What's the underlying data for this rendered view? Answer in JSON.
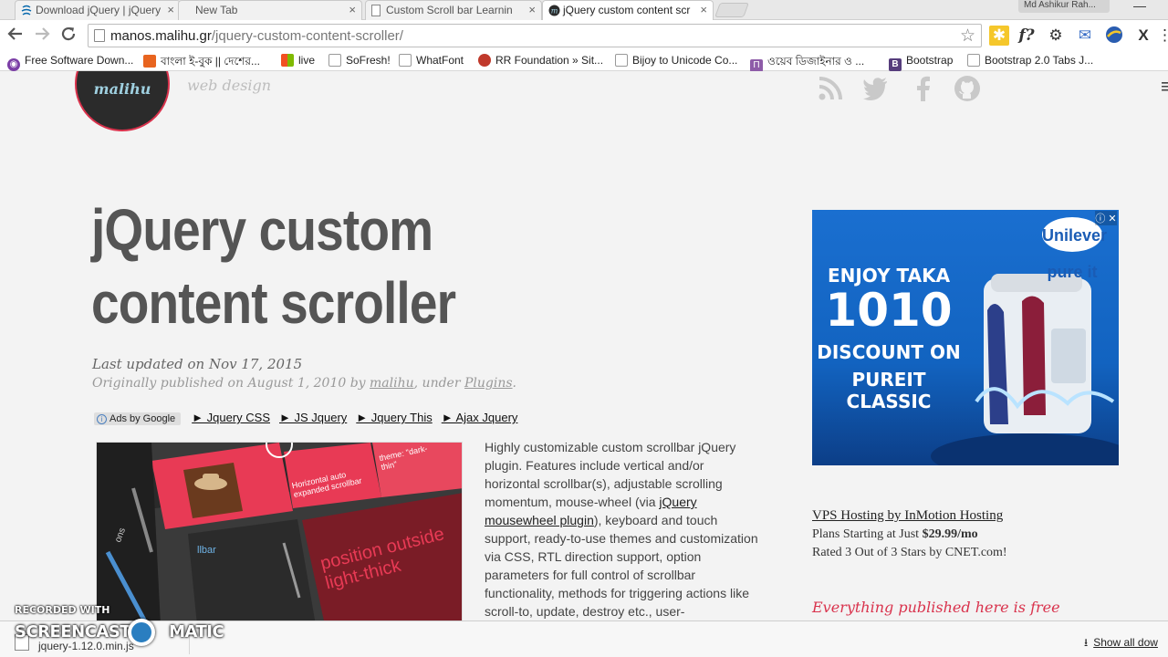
{
  "browser": {
    "tabs": [
      {
        "title": "Download jQuery | jQuery",
        "icon": "jquery-icon",
        "active": false
      },
      {
        "title": "New Tab",
        "icon": "",
        "active": false
      },
      {
        "title": "Custom Scroll bar Learnin",
        "icon": "page-icon",
        "active": false
      },
      {
        "title": "jQuery custom content scr",
        "icon": "malihu-icon",
        "active": true
      }
    ],
    "user_name": "Md Ashikur Rah...",
    "url_host": "manos.malihu.gr",
    "url_path": "/jquery-custom-content-scroller/",
    "bookmarks": [
      {
        "label": "Free Software Down...",
        "color": "#7b3ea6"
      },
      {
        "label": "বাংলা ই-বুক || দেশের...",
        "color": "#e8641f"
      },
      {
        "label": "live",
        "color": "#0078d7"
      },
      {
        "label": "SoFresh!",
        "color": "#888888"
      },
      {
        "label": "WhatFont",
        "color": "#888888"
      },
      {
        "label": "RR Foundation » Sit...",
        "color": "#c0392b"
      },
      {
        "label": "Bijoy to Unicode Co...",
        "color": "#888888"
      },
      {
        "label": "ওয়েব ডিজাইনার ও ...",
        "color": "#8e5ca8"
      },
      {
        "label": "Bootstrap",
        "color": "#563d7c"
      },
      {
        "label": "Bootstrap 2.0 Tabs J...",
        "color": "#888888"
      }
    ]
  },
  "site": {
    "logo_text": "malihu",
    "tagline": "web design"
  },
  "article": {
    "title": "jQuery custom content scroller",
    "updated": "Last updated on Nov 17, 2015",
    "published_prefix": "Originally published on August 1, 2010 by ",
    "author": "malihu",
    "published_mid": ", under ",
    "category": "Plugins",
    "published_end": ".",
    "ads_label": "Ads by Google",
    "ad_links": [
      "► Jquery CSS",
      "► JS Jquery",
      "► Jquery This",
      "► Ajax Jquery"
    ],
    "desc_1": "Highly customizable custom scrollbar jQuery plugin. Features include vertical and/or horizontal scrollbar(s), adjustable scrolling momentum, mouse-wheel (via ",
    "desc_link": "jQuery mousewheel plugin",
    "desc_2": "), keyboard and touch support, ready-to-use themes and customization via CSS, RTL direction support, option parameters for full control of scrollbar functionality, methods for triggering actions like scroll-to, update, destroy etc., user-",
    "thumb_labels": {
      "horizontal": "Horizontal auto expanded scrollbar",
      "theme": "theme: \"dark-thin\"",
      "position": "position outside light-thick",
      "llbar": "llbar",
      "ons": "ons"
    }
  },
  "sidebar": {
    "ad": {
      "brand": "Unilever pure it",
      "line1": "ENJOY TAKA",
      "amount": "1010",
      "line3": "DISCOUNT ON",
      "line4": "PUREIT CLASSIC"
    },
    "vps_title": "VPS Hosting by InMotion Hosting",
    "vps_price_prefix": "Plans Starting at Just ",
    "vps_price": "$29.99/mo",
    "vps_rating": "Rated 3 Out of 3 Stars by CNET.com!",
    "free_text": "Everything published here is free"
  },
  "downloads": {
    "file": "jquery-1.12.0.min.js",
    "show_all": "Show all dow"
  },
  "watermark": {
    "line1": "RECORDED WITH",
    "line2": "SCREENCAST",
    "line3": "MATIC"
  }
}
